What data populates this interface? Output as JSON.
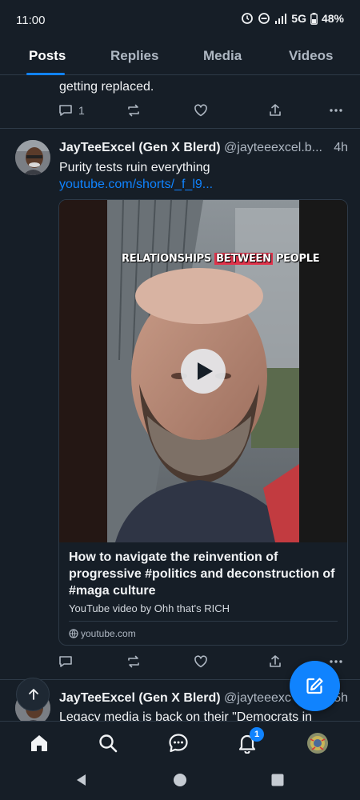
{
  "status_bar": {
    "time": "11:00",
    "network": "5G",
    "battery": "48%"
  },
  "tabs": [
    {
      "label": "Posts",
      "active": true
    },
    {
      "label": "Replies",
      "active": false
    },
    {
      "label": "Media",
      "active": false
    },
    {
      "label": "Videos",
      "active": false
    }
  ],
  "previous_post": {
    "text_partial_line1": "… … … … … … … …",
    "text_partial_line2": "getting replaced.",
    "reply_count": "1"
  },
  "post": {
    "author_name": "JayTeeExcel (Gen X Blerd)",
    "handle": "@jayteeexcel.b...",
    "time": "4h",
    "text": "Purity tests ruin everything ",
    "link": "youtube.com/shorts/_f_l9...",
    "embed": {
      "caption_part1": "RELATIONSHIPS ",
      "caption_highlight": "BETWEEN",
      "caption_part2": " PEOPLE",
      "title": "How to navigate the reinvention of progressive #politics and deconstruction of #maga culture",
      "description": "YouTube video by Ohh that's RICH",
      "domain": "youtube.com"
    }
  },
  "next_post": {
    "author_name": "JayTeeExcel (Gen X Blerd)",
    "handle": "@jayteeexc",
    "time": "5h",
    "text": "Legacy media is back on their \"Democrats in"
  },
  "bottom_nav": {
    "notification_count": "1"
  },
  "colors": {
    "background": "#161e27",
    "accent": "#1083fe",
    "text_primary": "#f1f3f5",
    "text_secondary": "#aeb7c2",
    "divider": "#2e3a47"
  },
  "icons": {
    "tabs_bar": [],
    "actions": [
      "reply-icon",
      "repost-icon",
      "like-icon",
      "share-icon",
      "more-icon"
    ],
    "nav": [
      "home-icon",
      "search-icon",
      "chat-icon",
      "bell-icon",
      "profile-avatar"
    ]
  }
}
